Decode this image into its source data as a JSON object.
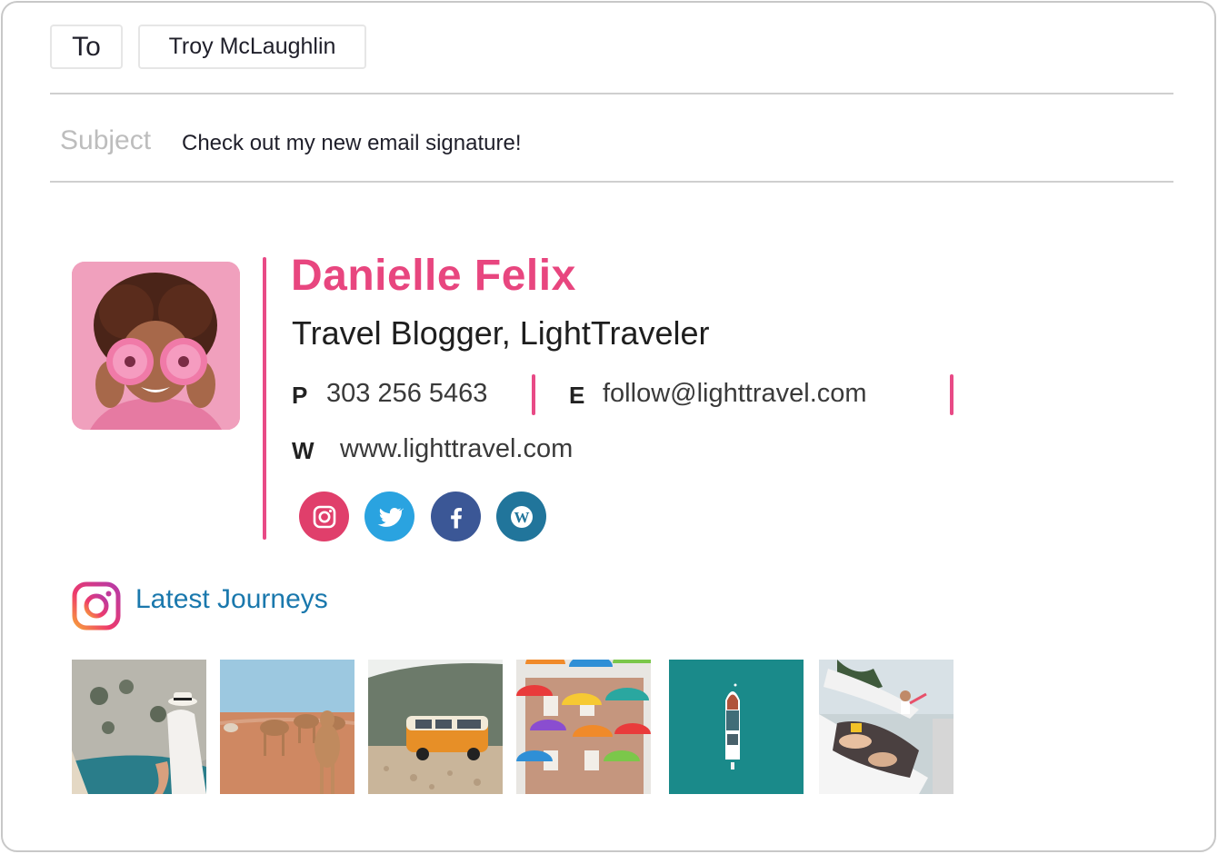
{
  "compose": {
    "to_label": "To",
    "recipient": "Troy McLaughlin",
    "subject_label": "Subject",
    "subject_value": "Check out my new email signature!"
  },
  "signature": {
    "name": "Danielle Felix",
    "title": "Travel Blogger, LightTraveler",
    "accent_color": "#e8467f",
    "avatar_alt": "Woman holding pink gerbera flowers over her eyes",
    "contacts": [
      {
        "label": "P",
        "value": "303 256 5463"
      },
      {
        "label": "E",
        "value": "follow@lighttravel.com"
      },
      {
        "label": "W",
        "value": "www.lighttravel.com"
      }
    ],
    "social": [
      {
        "name": "instagram",
        "icon": "instagram-icon",
        "color": "#e03f6b"
      },
      {
        "name": "twitter",
        "icon": "twitter-icon",
        "color": "#2aa3e0"
      },
      {
        "name": "facebook",
        "icon": "facebook-icon",
        "color": "#3b5796"
      },
      {
        "name": "wordpress",
        "icon": "wordpress-icon",
        "color": "#21759b"
      }
    ]
  },
  "journeys": {
    "title": "Latest Journeys",
    "title_color": "#1a78ad",
    "photos": [
      {
        "alt": "Woman in white hat sitting on seaside cliffs"
      },
      {
        "alt": "Camels in desert"
      },
      {
        "alt": "Orange camper van in mountains"
      },
      {
        "alt": "Colorful umbrellas over street"
      },
      {
        "alt": "Aerial view of boat on turquoise water"
      },
      {
        "alt": "Friends relaxing in camper van"
      }
    ]
  }
}
